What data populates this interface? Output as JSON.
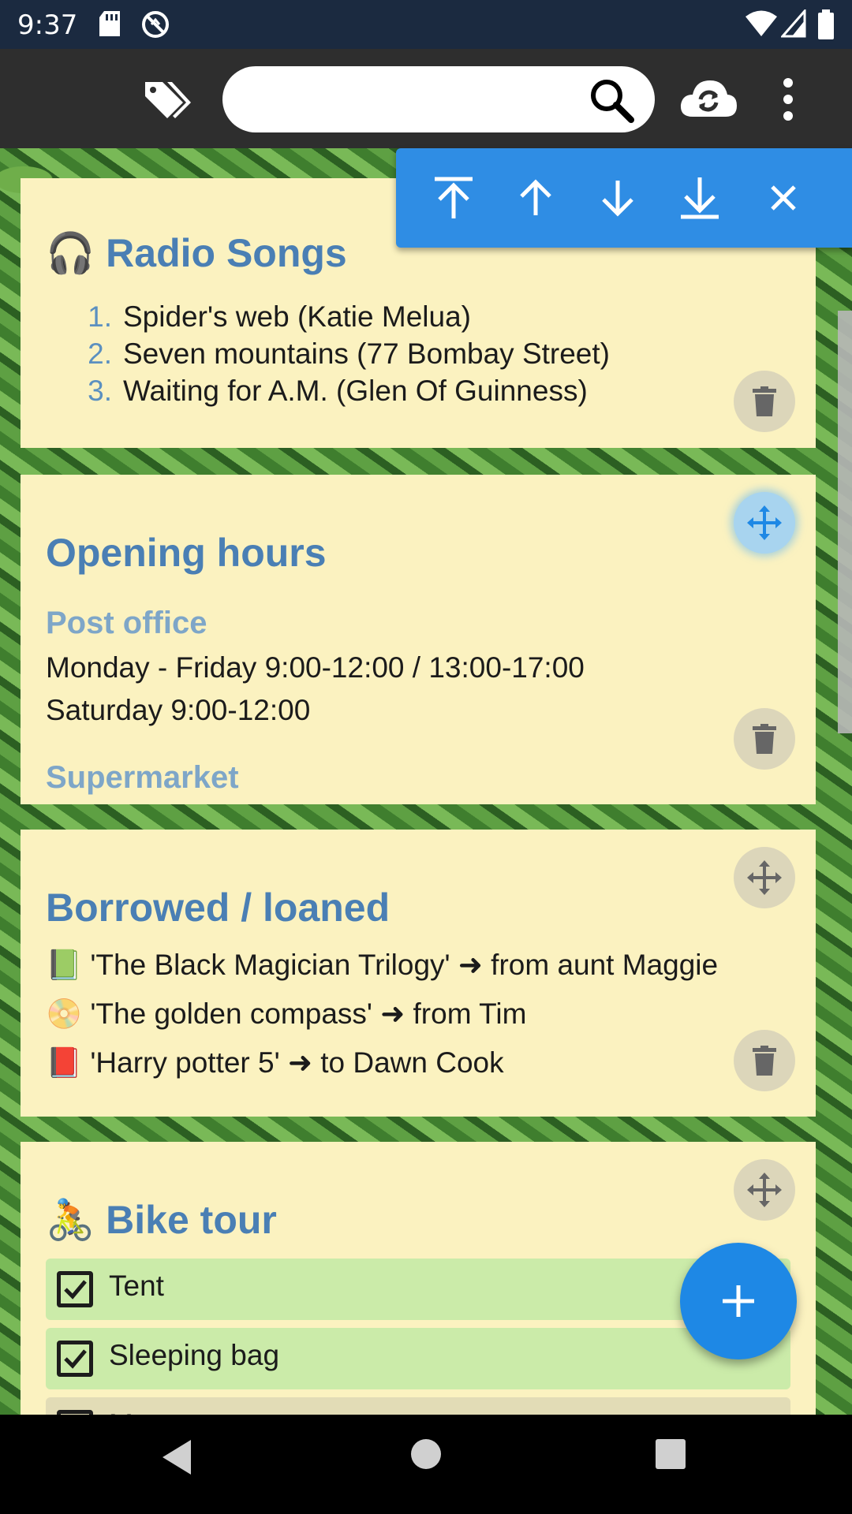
{
  "status_bar": {
    "time": "9:37",
    "icons": [
      "sd-card-icon",
      "sync-disabled-icon",
      "wifi-icon",
      "signal-icon",
      "battery-icon"
    ]
  },
  "app_bar": {
    "search": {
      "value": "",
      "placeholder": ""
    },
    "icons": [
      "tags-icon",
      "search-icon",
      "cloud-sync-icon",
      "more-vert-icon"
    ]
  },
  "move_toolbar": {
    "buttons": [
      "move-to-top",
      "move-up",
      "move-down",
      "move-to-bottom",
      "close"
    ]
  },
  "cards": {
    "radio": {
      "emoji": "🎧",
      "title": "Radio Songs",
      "items": [
        {
          "num": "1.",
          "text": "Spider's web (Katie Melua)"
        },
        {
          "num": "2.",
          "text": "Seven mountains (77 Bombay Street)"
        },
        {
          "num": "3.",
          "text": "Waiting for A.M. (Glen Of Guinness)"
        }
      ]
    },
    "opening": {
      "title": "Opening hours",
      "post_office": "Post office",
      "line1": "Monday - Friday 9:00-12:00 / 13:00-17:00",
      "line2": "Saturday 9:00-12:00",
      "supermarket": "Supermarket"
    },
    "borrowed": {
      "title": "Borrowed / loaned",
      "items": [
        {
          "emoji": "📗",
          "text": "'The Black Magician Trilogy' ➜ from aunt Maggie"
        },
        {
          "emoji": "📀",
          "text": "'The golden compass' ➜ from Tim"
        },
        {
          "emoji": "📕",
          "text": "'Harry potter 5' ➜ to Dawn Cook"
        }
      ]
    },
    "bike": {
      "emoji": "🚴",
      "title": "Bike tour",
      "items": [
        {
          "label": "Tent",
          "checked": true
        },
        {
          "label": "Sleeping bag",
          "checked": true
        },
        {
          "label": "Maps",
          "checked": false
        }
      ]
    }
  },
  "colors": {
    "card_bg": "#fbf2c0",
    "title": "#4a7fb4",
    "accent": "#1e88e5",
    "checked_row": "#cbeba9"
  }
}
